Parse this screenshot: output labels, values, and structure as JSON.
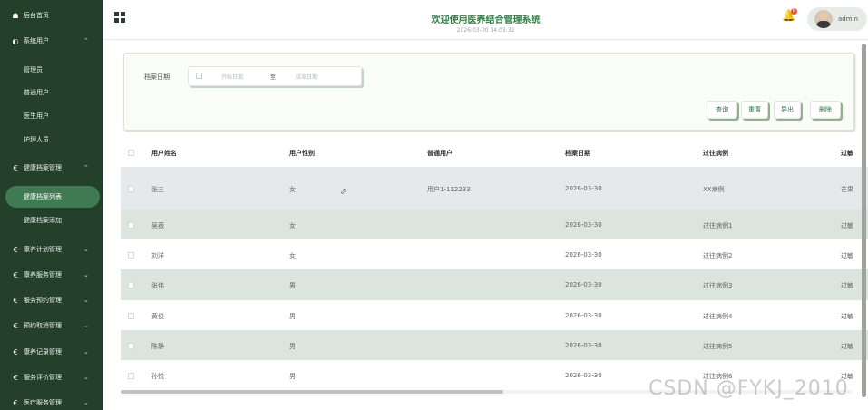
{
  "sidebar": {
    "home": {
      "icon": "home-icon",
      "label": "后台首页"
    },
    "groups": [
      {
        "label": "系统用户",
        "icon": "user-circle-icon",
        "expanded": true,
        "children": [
          "管理员",
          "普通用户",
          "医生用户",
          "护理人员"
        ]
      },
      {
        "label": "健康档案管理",
        "icon": "euro-icon",
        "expanded": true,
        "children": [
          "健康档案列表",
          "健康档案添加"
        ],
        "active_child": "健康档案列表"
      },
      {
        "label": "康养计划管理",
        "icon": "euro-icon"
      },
      {
        "label": "康养服务管理",
        "icon": "euro-icon"
      },
      {
        "label": "服务预约管理",
        "icon": "euro-icon"
      },
      {
        "label": "预约取消管理",
        "icon": "euro-icon"
      },
      {
        "label": "康养记录管理",
        "icon": "euro-icon"
      },
      {
        "label": "服务评价管理",
        "icon": "euro-icon"
      },
      {
        "label": "医疗服务管理",
        "icon": "euro-icon"
      }
    ]
  },
  "header": {
    "title": "欢迎使用医养结合管理系统",
    "datetime": "2026-03-30 14:03:32",
    "notification_count": "6",
    "username": "admin"
  },
  "search": {
    "date_label": "档案日期",
    "start_placeholder": "开始日期",
    "separator": "至",
    "end_placeholder": "结束日期",
    "buttons": {
      "query": "查询",
      "reset": "重置",
      "export": "导出",
      "delete": "删除"
    }
  },
  "table": {
    "columns": [
      "用户姓名",
      "用户性别",
      "普通用户",
      "档案日期",
      "过往病例",
      "过敏"
    ],
    "rows": [
      [
        "张三",
        "女",
        "用户1-112233",
        "2026-03-30",
        "XX病例",
        "芒果"
      ],
      [
        "吴薇",
        "女",
        "",
        "2026-03-30",
        "过往病例1",
        "过敏"
      ],
      [
        "刘洋",
        "女",
        "",
        "2026-03-30",
        "过往病例2",
        "过敏"
      ],
      [
        "张伟",
        "男",
        "",
        "2026-03-30",
        "过往病例3",
        "过敏"
      ],
      [
        "黄俊",
        "男",
        "",
        "2026-03-30",
        "过往病例4",
        "过敏"
      ],
      [
        "陈静",
        "男",
        "",
        "2026-03-30",
        "过往病例5",
        "过敏"
      ],
      [
        "孙悦",
        "男",
        "",
        "2026-03-30",
        "过往病例6",
        "过敏"
      ]
    ]
  },
  "colors": {
    "sidebar_bg": "#24402b",
    "accent": "#2f7d44",
    "row_hover": "#e5e9ec",
    "row_stripe": "#dce5dd"
  },
  "watermark": "CSDN @FYKJ_2010"
}
